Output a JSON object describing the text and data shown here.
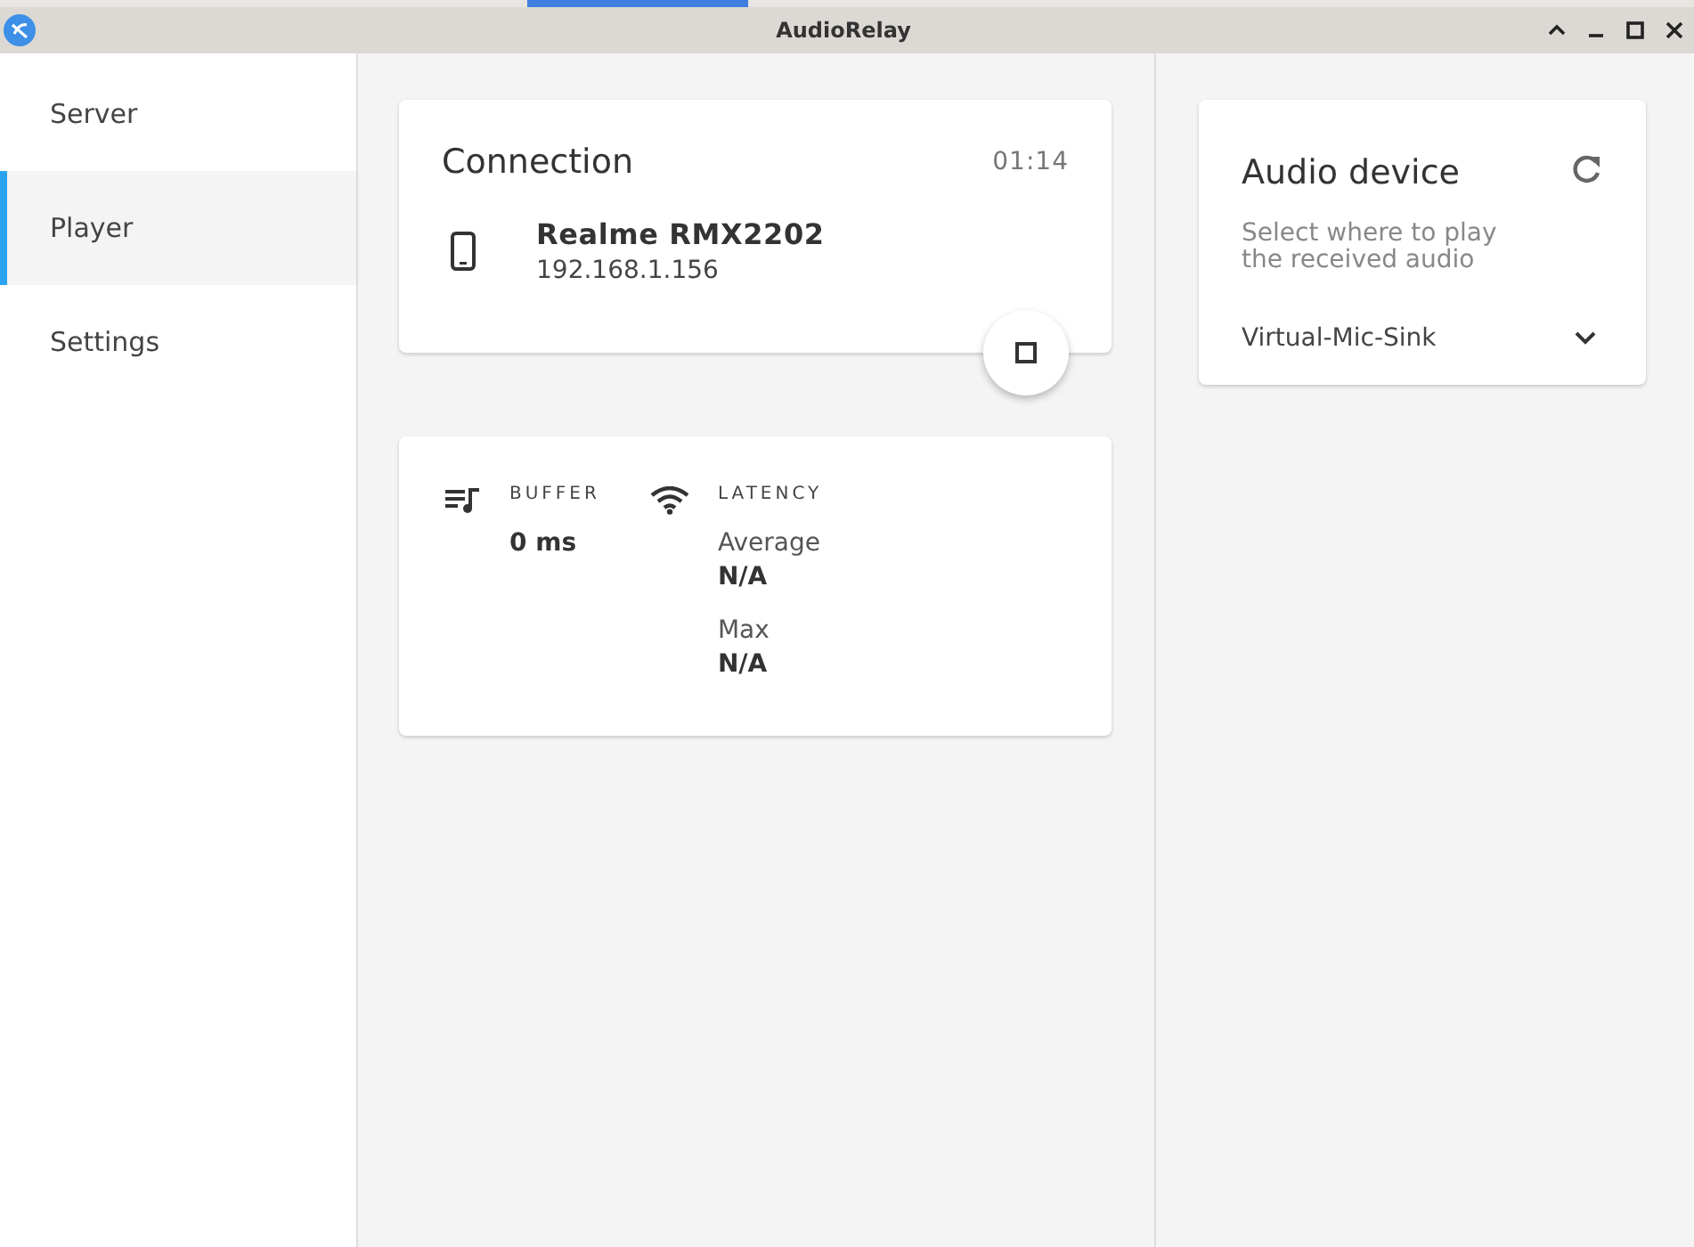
{
  "window": {
    "title": "AudioRelay"
  },
  "sidebar": {
    "items": [
      {
        "label": "Server",
        "selected": false
      },
      {
        "label": "Player",
        "selected": true
      },
      {
        "label": "Settings",
        "selected": false
      }
    ]
  },
  "connection": {
    "title": "Connection",
    "duration": "01:14",
    "device_name": "Realme RMX2202",
    "address": "192.168.1.156"
  },
  "stats": {
    "buffer": {
      "label": "BUFFER",
      "value": "0 ms"
    },
    "latency": {
      "label": "LATENCY",
      "rows": [
        {
          "label": "Average",
          "value": "N/A"
        },
        {
          "label": "Max",
          "value": "N/A"
        }
      ]
    }
  },
  "audio_device": {
    "title": "Audio device",
    "description": "Select where to play the received audio",
    "selected_device": "Virtual-Mic-Sink"
  }
}
